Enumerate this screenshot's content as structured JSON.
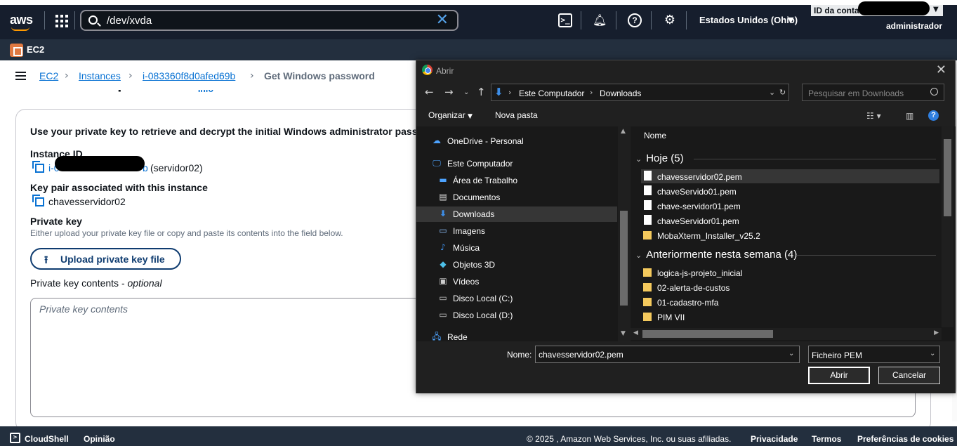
{
  "topbar": {
    "logo": "aws",
    "search_value": "/dev/xvda",
    "region": "Estados Unidos (Ohio)",
    "account_label": "ID da conta:",
    "user": "administrador",
    "icons": [
      "grid-icon",
      "search-icon",
      "close-icon",
      "cloudshell-icon",
      "bell-icon",
      "help-icon",
      "gear-icon"
    ]
  },
  "servicebar": {
    "service": "EC2"
  },
  "breadcrumb": {
    "items": [
      {
        "label": "EC2"
      },
      {
        "label": "Instances"
      },
      {
        "label": "i-083360f8d0afed69b"
      },
      {
        "label": "Get Windows password"
      }
    ]
  },
  "page": {
    "title": "Get Windows password",
    "info": "Info",
    "intro": "Use your private key to retrieve and decrypt the initial Windows administrator passw",
    "instance_id_label": "Instance ID",
    "instance_id_prefix": "i-0",
    "instance_id_suffix": "b",
    "instance_name": "(servidor02)",
    "keypair_label": "Key pair associated with this instance",
    "keypair_value": "chavesservidor02",
    "private_key_label": "Private key",
    "private_key_help": "Either upload your private key file or copy and paste its contents into the field below.",
    "upload_button": "Upload private key file",
    "contents_label": "Private key contents",
    "contents_optional": "optional",
    "contents_placeholder": "Private key contents"
  },
  "footer": {
    "cloudshell": "CloudShell",
    "feedback": "Opinião",
    "copyright": "© 2025 , Amazon Web Services, Inc. ou suas afiliadas.",
    "privacy": "Privacidade",
    "terms": "Termos",
    "cookies": "Preferências de cookies"
  },
  "dialog": {
    "title": "Abrir",
    "path": [
      "Este Computador",
      "Downloads"
    ],
    "search_placeholder": "Pesquisar em Downloads",
    "organize": "Organizar",
    "new_folder": "Nova pasta",
    "nav_items": [
      {
        "label": "OneDrive - Personal",
        "icon": "cloud-icon"
      },
      {
        "label": "Este Computador",
        "icon": "computer-icon"
      },
      {
        "label": "Área de Trabalho",
        "icon": "desktop-icon"
      },
      {
        "label": "Documentos",
        "icon": "document-icon"
      },
      {
        "label": "Downloads",
        "icon": "download-icon",
        "selected": true
      },
      {
        "label": "Imagens",
        "icon": "image-icon"
      },
      {
        "label": "Música",
        "icon": "music-icon"
      },
      {
        "label": "Objetos 3D",
        "icon": "cube-icon"
      },
      {
        "label": "Vídeos",
        "icon": "video-icon"
      },
      {
        "label": "Disco Local (C:)",
        "icon": "drive-icon"
      },
      {
        "label": "Disco Local (D:)",
        "icon": "drive-icon"
      },
      {
        "label": "Rede",
        "icon": "network-icon"
      }
    ],
    "column_name": "Nome",
    "groups": [
      {
        "label": "Hoje (5)",
        "files": [
          {
            "name": "chavesservidor02.pem",
            "kind": "file",
            "selected": true
          },
          {
            "name": "chaveServido01.pem",
            "kind": "file"
          },
          {
            "name": "chave-servidor01.pem",
            "kind": "file"
          },
          {
            "name": "chaveServidor01.pem",
            "kind": "file"
          },
          {
            "name": "MobaXterm_Installer_v25.2",
            "kind": "folder"
          }
        ]
      },
      {
        "label": "Anteriormente nesta semana (4)",
        "files": [
          {
            "name": "logica-js-projeto_inicial",
            "kind": "folder"
          },
          {
            "name": "02-alerta-de-custos",
            "kind": "folder"
          },
          {
            "name": "01-cadastro-mfa",
            "kind": "folder"
          },
          {
            "name": "PIM VII",
            "kind": "folder"
          }
        ]
      }
    ],
    "name_label": "Nome:",
    "name_value": "chavesservidor02.pem",
    "file_type": "Ficheiro PEM",
    "open_button": "Abrir",
    "cancel_button": "Cancelar"
  }
}
